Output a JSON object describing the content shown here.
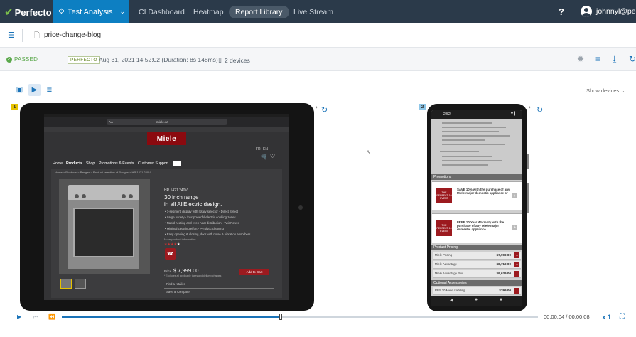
{
  "topbar": {
    "logo_text": "Perfecto",
    "app_tab": "Test Analysis",
    "nav": [
      "CI Dashboard",
      "Heatmap",
      "Report Library",
      "Live Stream"
    ],
    "active_nav": "Report Library",
    "help": "?",
    "username": "johnnyl@per..."
  },
  "breadcrumb": {
    "report_name": "price-change-blog"
  },
  "summary": {
    "status": "PASSED",
    "badge": "PERFECTO",
    "datetime": "Aug 31, 2021 14:52:02 (Duration: 8s 148ms)",
    "devices": "2 devices"
  },
  "devices_panel": {
    "show_devices": "Show devices",
    "device1_number": "1",
    "device2_number": "2"
  },
  "tablet_page": {
    "url": "miele.ca",
    "logo": "Miele",
    "lang": [
      "FR",
      "EN"
    ],
    "menu": [
      "Home",
      "Products",
      "Shop",
      "Promotions & Events",
      "Customer Support"
    ],
    "breadcrumb": "Home > Products > Ranges > Product selection of Ranges > HR 1421 240V",
    "model": "HR 1421 240V",
    "title_line1": "30 inch range",
    "title_line2": "in all AllElectric design.",
    "features": [
      "7-segment display with rotary selector - Direct Select",
      "Large variety - four powerful electric cooking zones",
      "Rapid heating and even heat distribution - TwinPower",
      "Minimal cleaning effort - Pyrolytic cleaning",
      "Easy opening & closing, door with noise & vibration absorbers"
    ],
    "more_info": "More product information",
    "price_label": "Price",
    "price": "$ 7,999.00",
    "price_note": "* Excludes all applicable taxes and delivery charges",
    "add_to_cart": "Add to Cart",
    "find_retailer": "Find a retailer",
    "save_compare": "Save & Compare"
  },
  "phone_page": {
    "status_time": "2:52",
    "promotions_header": "Promotions",
    "promo1": "SAVE 10% with the purchase of any Miele major domestic appliance or",
    "promo2": "FREE 10 Year Warranty with the purchase of any Miele major domestic appliance",
    "promo_logo": "THE PERFECT 10 EVENT",
    "pricing_header": "Product Pricing",
    "pricing": [
      {
        "label": "Miele Pricing",
        "value": "$7,999.00"
      },
      {
        "label": "Miele Advantage",
        "value": "$8,719.00"
      },
      {
        "label": "Miele Advantage Plus",
        "value": "$9,639.00"
      }
    ],
    "accessories_header": "Optional Accessories",
    "accessory": {
      "label": "RBS 30 Miele cladding",
      "value": "$299.00"
    }
  },
  "player": {
    "timestamp": "00:00:04 / 00:00:08",
    "speed": "x 1",
    "progress": 0.46
  },
  "colors": {
    "topbar": "#2b3a4a",
    "accent": "#0d7fc2",
    "passed": "#5aa84b",
    "miele_red": "#8b0a0f"
  }
}
